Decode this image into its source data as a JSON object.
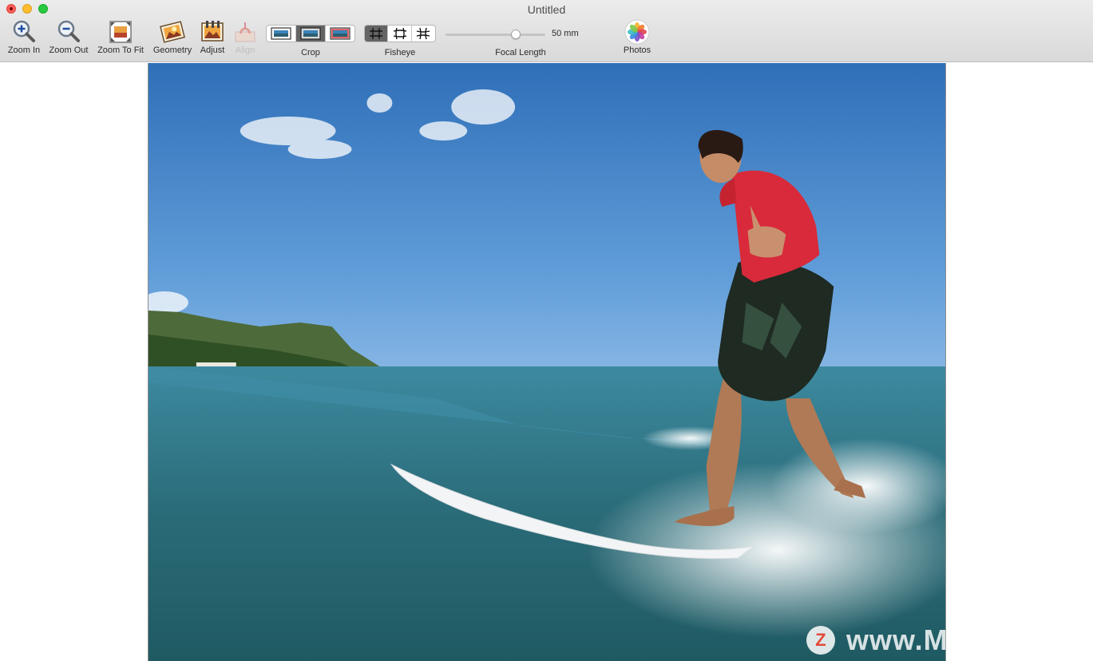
{
  "window": {
    "title": "Untitled"
  },
  "toolbar": {
    "zoom_in": "Zoom In",
    "zoom_out": "Zoom Out",
    "zoom_to_fit": "Zoom To Fit",
    "geometry": "Geometry",
    "adjust": "Adjust",
    "align": "Align",
    "crop": "Crop",
    "fisheye": "Fisheye",
    "focal_length": "Focal Length",
    "focal_length_value": "50 mm",
    "photos": "Photos"
  },
  "state": {
    "crop_selected": 1,
    "fisheye_selected": 0,
    "align_enabled": false,
    "focal_slider_level": 0.7
  },
  "watermark": {
    "badge": "Z",
    "text": "www.MacZ.com"
  },
  "colors": {
    "sky": "#4a86c8",
    "sea": "#2c6e7a",
    "shirt": "#d82a3a",
    "close": "#fd5f57",
    "minimize": "#febc2e",
    "maximize": "#28c840"
  }
}
